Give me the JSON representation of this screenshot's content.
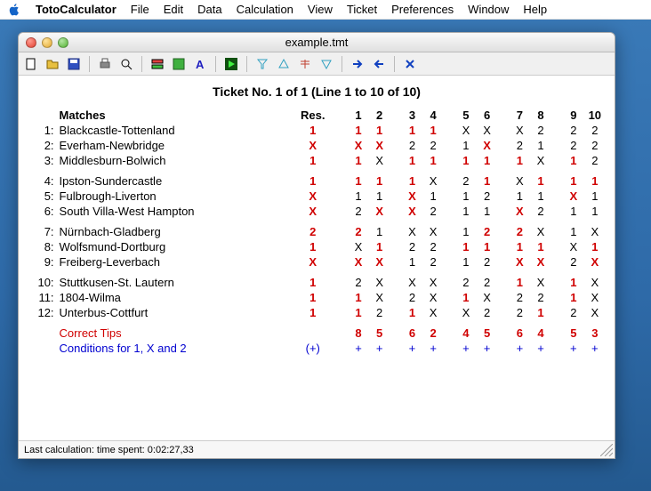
{
  "menubar": {
    "appname": "TotoCalculator",
    "items": [
      "File",
      "Edit",
      "Data",
      "Calculation",
      "View",
      "Ticket",
      "Preferences",
      "Window",
      "Help"
    ]
  },
  "window": {
    "title": "example.tmt"
  },
  "ticket": {
    "title": "Ticket No. 1 of 1 (Line 1 to 10 of 10)",
    "headers": {
      "matches": "Matches",
      "res": "Res."
    },
    "cols": [
      "1",
      "2",
      "3",
      "4",
      "5",
      "6",
      "7",
      "8",
      "9",
      "10"
    ],
    "groups": [
      [
        {
          "idx": "1",
          "match": "Blackcastle-Tottenland",
          "res": "1",
          "cells": [
            "1",
            "1",
            "1",
            "1",
            "X",
            "X",
            "X",
            "2",
            "2",
            "2"
          ]
        },
        {
          "idx": "2",
          "match": "Everham-Newbridge",
          "res": "X",
          "cells": [
            "X",
            "X",
            "2",
            "2",
            "1",
            "X",
            "2",
            "1",
            "2",
            "2"
          ]
        },
        {
          "idx": "3",
          "match": "Middlesburn-Bolwich",
          "res": "1",
          "cells": [
            "1",
            "X",
            "1",
            "1",
            "1",
            "1",
            "1",
            "X",
            "1",
            "2"
          ]
        }
      ],
      [
        {
          "idx": "4",
          "match": "Ipston-Sundercastle",
          "res": "1",
          "cells": [
            "1",
            "1",
            "1",
            "X",
            "2",
            "1",
            "X",
            "1",
            "1",
            "1"
          ]
        },
        {
          "idx": "5",
          "match": "Fulbrough-Liverton",
          "res": "X",
          "cells": [
            "1",
            "1",
            "X",
            "1",
            "1",
            "2",
            "1",
            "1",
            "X",
            "1"
          ]
        },
        {
          "idx": "6",
          "match": "South Villa-West Hampton",
          "res": "X",
          "cells": [
            "2",
            "X",
            "X",
            "2",
            "1",
            "1",
            "X",
            "2",
            "1",
            "1"
          ]
        }
      ],
      [
        {
          "idx": "7",
          "match": "Nürnbach-Gladberg",
          "res": "2",
          "cells": [
            "2",
            "1",
            "X",
            "X",
            "1",
            "2",
            "2",
            "X",
            "1",
            "X"
          ]
        },
        {
          "idx": "8",
          "match": "Wolfsmund-Dortburg",
          "res": "1",
          "cells": [
            "X",
            "1",
            "2",
            "2",
            "1",
            "1",
            "1",
            "1",
            "X",
            "1"
          ]
        },
        {
          "idx": "9",
          "match": "Freiberg-Leverbach",
          "res": "X",
          "cells": [
            "X",
            "X",
            "1",
            "2",
            "1",
            "2",
            "X",
            "X",
            "2",
            "X"
          ]
        }
      ],
      [
        {
          "idx": "10",
          "match": "Stuttkusen-St. Lautern",
          "res": "1",
          "cells": [
            "2",
            "X",
            "X",
            "X",
            "2",
            "2",
            "1",
            "X",
            "1",
            "X"
          ]
        },
        {
          "idx": "11",
          "match": "1804-Wilma",
          "res": "1",
          "cells": [
            "1",
            "X",
            "2",
            "X",
            "1",
            "X",
            "2",
            "2",
            "1",
            "X"
          ]
        },
        {
          "idx": "12",
          "match": "Unterbus-Cottfurt",
          "res": "1",
          "cells": [
            "1",
            "2",
            "1",
            "X",
            "X",
            "2",
            "2",
            "1",
            "2",
            "X"
          ]
        }
      ]
    ],
    "correct": {
      "label": "Correct Tips",
      "vals": [
        "8",
        "5",
        "6",
        "2",
        "4",
        "5",
        "6",
        "4",
        "5",
        "3"
      ]
    },
    "conditions": {
      "label": "Conditions for 1, X and 2",
      "toggle": "(+)",
      "vals": [
        "+",
        "+",
        "+",
        "+",
        "+",
        "+",
        "+",
        "+",
        "+",
        "+"
      ]
    }
  },
  "status": "Last calculation: time spent: 0:02:27,33"
}
